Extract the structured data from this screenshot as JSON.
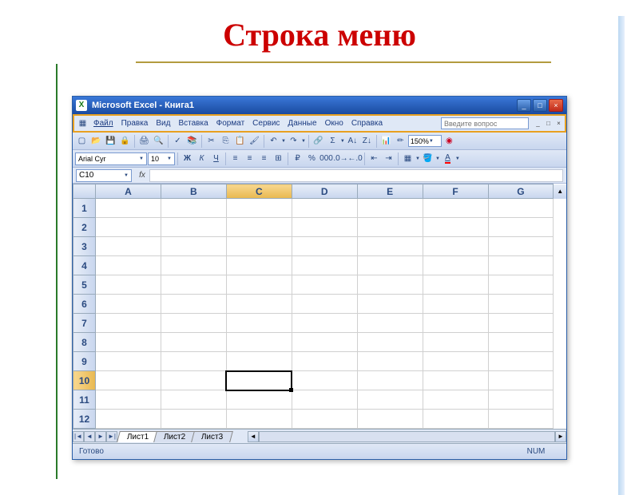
{
  "slide": {
    "title": "Строка меню"
  },
  "titlebar": {
    "app_glyph": "X",
    "text": "Microsoft Excel - Книга1"
  },
  "menubar": {
    "items": [
      "Файл",
      "Правка",
      "Вид",
      "Вставка",
      "Формат",
      "Сервис",
      "Данные",
      "Окно",
      "Справка"
    ],
    "help_placeholder": "Введите вопрос"
  },
  "toolbar": {
    "zoom": "150%"
  },
  "format_bar": {
    "font": "Arial Cyr",
    "size": "10"
  },
  "formula_bar": {
    "namebox": "C10",
    "fx": "fx"
  },
  "grid": {
    "columns": [
      "A",
      "B",
      "C",
      "D",
      "E",
      "F",
      "G"
    ],
    "rows": [
      "1",
      "2",
      "3",
      "4",
      "5",
      "6",
      "7",
      "8",
      "9",
      "10",
      "11",
      "12"
    ],
    "selected_col": "C",
    "selected_row": "10",
    "active_cell": "C10"
  },
  "tabs": {
    "nav": [
      "|◄",
      "◄",
      "►",
      "►|"
    ],
    "sheets": [
      "Лист1",
      "Лист2",
      "Лист3"
    ],
    "active": "Лист1"
  },
  "status": {
    "ready": "Готово",
    "num": "NUM"
  }
}
